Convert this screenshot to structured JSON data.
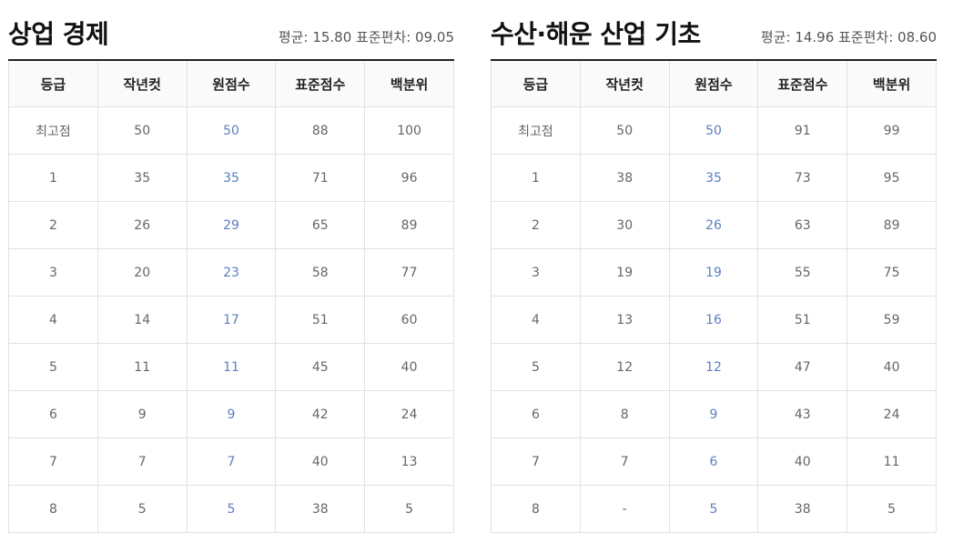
{
  "columns": [
    "등급",
    "작년컷",
    "원점수",
    "표준점수",
    "백분위"
  ],
  "subjects": [
    {
      "title": "상업 경제",
      "stats": "평균: 15.80 표준편차: 09.05",
      "rows": [
        [
          "최고점",
          "50",
          "50",
          "88",
          "100"
        ],
        [
          "1",
          "35",
          "35",
          "71",
          "96"
        ],
        [
          "2",
          "26",
          "29",
          "65",
          "89"
        ],
        [
          "3",
          "20",
          "23",
          "58",
          "77"
        ],
        [
          "4",
          "14",
          "17",
          "51",
          "60"
        ],
        [
          "5",
          "11",
          "11",
          "45",
          "40"
        ],
        [
          "6",
          "9",
          "9",
          "42",
          "24"
        ],
        [
          "7",
          "7",
          "7",
          "40",
          "13"
        ],
        [
          "8",
          "5",
          "5",
          "38",
          "5"
        ]
      ]
    },
    {
      "title": "수산·해운 산업 기초",
      "stats": "평균: 14.96 표준편차: 08.60",
      "rows": [
        [
          "최고점",
          "50",
          "50",
          "91",
          "99"
        ],
        [
          "1",
          "38",
          "35",
          "73",
          "95"
        ],
        [
          "2",
          "30",
          "26",
          "63",
          "89"
        ],
        [
          "3",
          "19",
          "19",
          "55",
          "75"
        ],
        [
          "4",
          "13",
          "16",
          "51",
          "59"
        ],
        [
          "5",
          "12",
          "12",
          "47",
          "40"
        ],
        [
          "6",
          "8",
          "9",
          "43",
          "24"
        ],
        [
          "7",
          "7",
          "6",
          "40",
          "11"
        ],
        [
          "8",
          "-",
          "5",
          "38",
          "5"
        ]
      ]
    }
  ],
  "colors": {
    "raw_score": "#5b7fc2",
    "header_border": "#222222"
  }
}
